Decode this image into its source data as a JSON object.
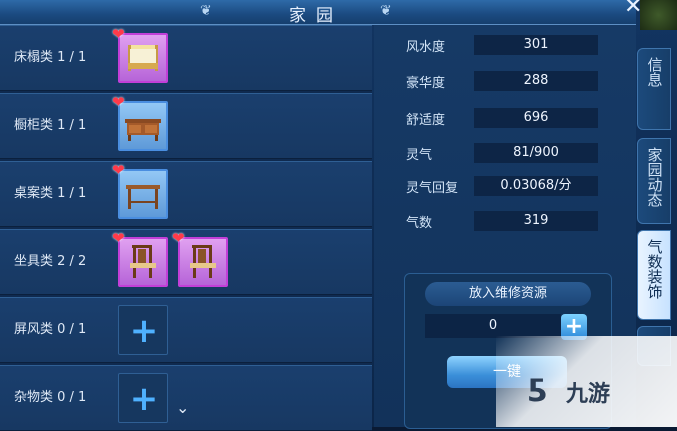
{
  "window": {
    "title": "家园"
  },
  "categories": [
    {
      "label": "床榻类 1 / 1",
      "slots": [
        {
          "rarity": "purple",
          "icon": "bed-icon",
          "favorite": true
        }
      ]
    },
    {
      "label": "橱柜类 1 / 1",
      "slots": [
        {
          "rarity": "blue",
          "icon": "cabinet-icon",
          "favorite": true
        }
      ]
    },
    {
      "label": "桌案类 1 / 1",
      "slots": [
        {
          "rarity": "blue",
          "icon": "table-icon",
          "favorite": true
        }
      ]
    },
    {
      "label": "坐具类 2 / 2",
      "slots": [
        {
          "rarity": "purple",
          "icon": "chair-icon",
          "favorite": true
        },
        {
          "rarity": "purple",
          "icon": "chair-icon",
          "favorite": true
        }
      ]
    },
    {
      "label": "屏风类 0 / 1",
      "slots": []
    },
    {
      "label": "杂物类 0 / 1",
      "slots": []
    }
  ],
  "stats": [
    {
      "label": "风水度",
      "value": "301"
    },
    {
      "label": "豪华度",
      "value": "288"
    },
    {
      "label": "舒适度",
      "value": "696"
    },
    {
      "label": "灵气",
      "value": "81/900"
    },
    {
      "label": "灵气回复",
      "value": "0.03068/分"
    },
    {
      "label": "气数",
      "value": "319"
    }
  ],
  "repair": {
    "title": "放入维修资源",
    "value": "0",
    "confirm_label": "一键"
  },
  "tabs": [
    {
      "label": "信息",
      "active": false
    },
    {
      "label": "家园动态",
      "active": false
    },
    {
      "label": "气数装饰",
      "active": true
    }
  ],
  "colors": {
    "purple_rarity": "#c23fd8",
    "blue_rarity": "#4a8ee0",
    "heart": "#ff3a4a",
    "plus": "#4fb1ff"
  },
  "watermark": {
    "text": "九游"
  }
}
